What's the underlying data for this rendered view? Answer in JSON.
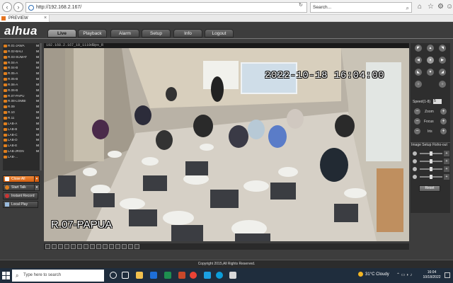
{
  "browser": {
    "url": "http://192.168.2.167/",
    "search_placeholder": "Search...",
    "tab_title": "PREVIEW"
  },
  "app": {
    "logo": "alhua",
    "menu": [
      {
        "label": "Live"
      },
      {
        "label": "Playback"
      },
      {
        "label": "Alarm"
      },
      {
        "label": "Setup"
      },
      {
        "label": "Info"
      },
      {
        "label": "Logout"
      }
    ]
  },
  "channels": [
    {
      "name": "R.01-JAWA",
      "flag": "M"
    },
    {
      "name": "R.02-BALI",
      "flag": "M"
    },
    {
      "name": "R.03-SUMAT",
      "flag": "M"
    },
    {
      "name": "R.04-A",
      "flag": "M"
    },
    {
      "name": "R.04-B",
      "flag": "M"
    },
    {
      "name": "R.05-A",
      "flag": "M"
    },
    {
      "name": "R.05-B",
      "flag": "M"
    },
    {
      "name": "R.06-A",
      "flag": "M"
    },
    {
      "name": "R.06-B",
      "flag": "M"
    },
    {
      "name": "R.07-PAPU",
      "flag": "M"
    },
    {
      "name": "R.08-LOMBI",
      "flag": "M"
    },
    {
      "name": "R.09",
      "flag": "M"
    },
    {
      "name": "R.10",
      "flag": "M"
    },
    {
      "name": "R.11",
      "flag": "M"
    },
    {
      "name": "LAB-A",
      "flag": "M"
    },
    {
      "name": "LAB-B",
      "flag": "M"
    },
    {
      "name": "LAB-C",
      "flag": "M"
    },
    {
      "name": "LAB-D",
      "flag": "M"
    },
    {
      "name": "LAB-E",
      "flag": "M"
    },
    {
      "name": "LAB-JRGN",
      "flag": "M"
    },
    {
      "name": "LAB-...",
      "flag": ""
    }
  ],
  "controls": {
    "close_all": "Close All",
    "start_talk": "Start Talk",
    "instant_record": "Instant Record",
    "local_play": "Local Play"
  },
  "video": {
    "title": "192.168.2.167_10_1110dBps_R",
    "osd_time": "2022-10-18 16:04:00",
    "osd_label": "R.07-PAPUA"
  },
  "ptz": {
    "speed_label": "Speed(1-8)",
    "speed_value": "5",
    "zoom_label": "Zoom",
    "focus_label": "Focus",
    "iris_label": "Iris"
  },
  "image_setup": {
    "tab_image": "Image Setup",
    "tab_fishout": "Fisho-out",
    "reset": "Reset"
  },
  "footer": {
    "copyright": "Copyright 2015,All Rights Reserved."
  },
  "taskbar": {
    "search_placeholder": "Type here to search",
    "weather": "31°C  Cloudy",
    "time": "16:04",
    "date": "10/18/2022"
  }
}
